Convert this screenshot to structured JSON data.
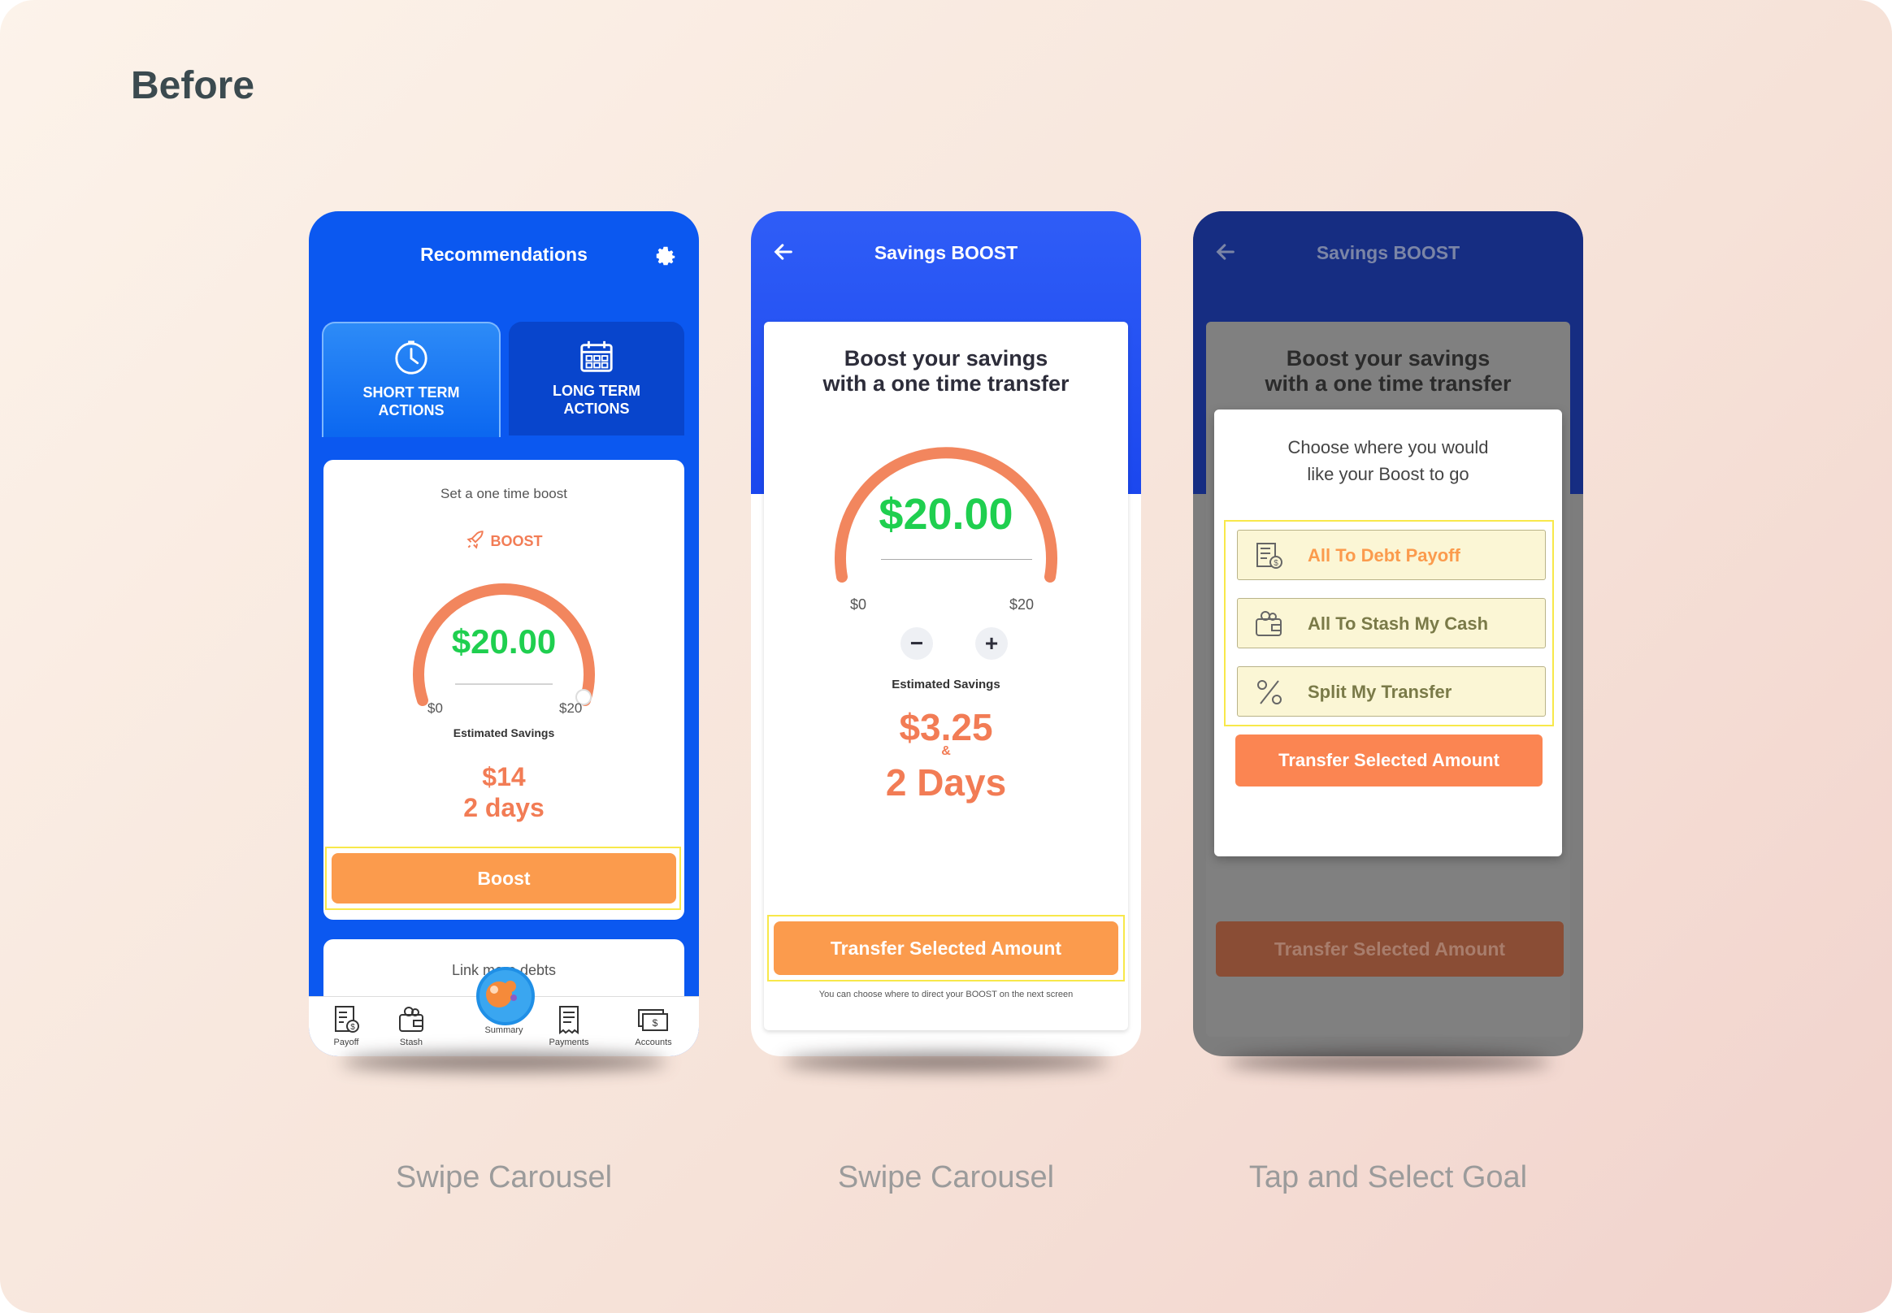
{
  "page": {
    "section_title": "Before"
  },
  "captions": [
    "Swipe Carousel",
    "Swipe Carousel",
    "Tap and Select Goal"
  ],
  "colors": {
    "primary_blue": "#0b58f0",
    "accent_orange": "#fb9b4d",
    "amount_green": "#1fcf4f",
    "highlight": "#f8e84a"
  },
  "screen1": {
    "title": "Recommendations",
    "tabs": [
      {
        "line1": "SHORT TERM",
        "line2": "ACTIONS",
        "icon": "clock-icon",
        "active": true
      },
      {
        "line1": "LONG TERM",
        "line2": "ACTIONS",
        "icon": "calendar-icon",
        "active": false
      }
    ],
    "card_subtitle": "Set a one time boost",
    "boost_tag": "BOOST",
    "amount": "$20.00",
    "range_min": "$0",
    "range_max": "$20",
    "estimated_label": "Estimated Savings",
    "estimated_value": "$14",
    "estimated_days": "2 days",
    "boost_button": "Boost",
    "next_card_text": "Link more debts",
    "tabbar": [
      "Payoff",
      "Stash",
      "Summary",
      "Payments",
      "Accounts"
    ]
  },
  "screen2": {
    "title": "Savings BOOST",
    "heading_line1": "Boost your savings",
    "heading_line2": "with a one time transfer",
    "amount": "$20.00",
    "range_min": "$0",
    "range_max": "$20",
    "minus": "−",
    "plus": "+",
    "estimated_label": "Estimated Savings",
    "estimated_value": "$3.25",
    "ampersand": "&",
    "estimated_days": "2 Days",
    "transfer_button": "Transfer Selected Amount",
    "note": "You can choose where to direct your BOOST on the next screen"
  },
  "screen3": {
    "title": "Savings BOOST",
    "heading_line1": "Boost your savings",
    "heading_line2": "with a one time transfer",
    "modal_line1": "Choose where you would",
    "modal_line2": "like your Boost to go",
    "options": [
      {
        "label": "All To Debt Payoff",
        "icon": "debt-payoff-icon"
      },
      {
        "label": "All To Stash My Cash",
        "icon": "wallet-icon"
      },
      {
        "label": "Split My Transfer",
        "icon": "percent-icon"
      }
    ],
    "modal_button": "Transfer Selected Amount",
    "background_button": "Transfer Selected Amount"
  }
}
